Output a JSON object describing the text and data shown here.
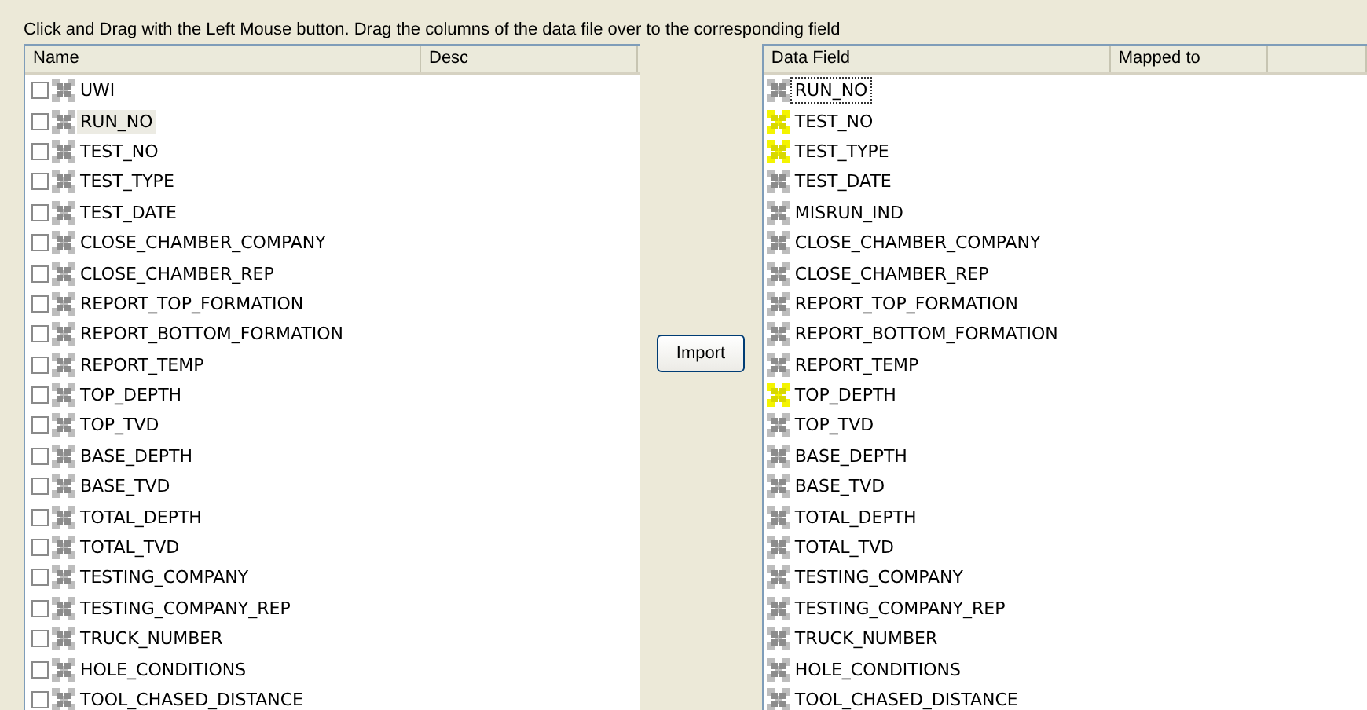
{
  "instruction": "Click and Drag with the Left Mouse button. Drag the columns of the data file over to the corresponding field",
  "source_list": {
    "columns": [
      "Name",
      "Desc"
    ],
    "rows": [
      {
        "name": "UWI",
        "checked": false,
        "selected": false
      },
      {
        "name": "RUN_NO",
        "checked": false,
        "selected": true
      },
      {
        "name": "TEST_NO",
        "checked": false,
        "selected": false
      },
      {
        "name": "TEST_TYPE",
        "checked": false,
        "selected": false
      },
      {
        "name": "TEST_DATE",
        "checked": false,
        "selected": false
      },
      {
        "name": "CLOSE_CHAMBER_COMPANY",
        "checked": false,
        "selected": false
      },
      {
        "name": "CLOSE_CHAMBER_REP",
        "checked": false,
        "selected": false
      },
      {
        "name": "REPORT_TOP_FORMATION",
        "checked": false,
        "selected": false
      },
      {
        "name": "REPORT_BOTTOM_FORMATION",
        "checked": false,
        "selected": false
      },
      {
        "name": "REPORT_TEMP",
        "checked": false,
        "selected": false
      },
      {
        "name": "TOP_DEPTH",
        "checked": false,
        "selected": false
      },
      {
        "name": "TOP_TVD",
        "checked": false,
        "selected": false
      },
      {
        "name": "BASE_DEPTH",
        "checked": false,
        "selected": false
      },
      {
        "name": "BASE_TVD",
        "checked": false,
        "selected": false
      },
      {
        "name": "TOTAL_DEPTH",
        "checked": false,
        "selected": false
      },
      {
        "name": "TOTAL_TVD",
        "checked": false,
        "selected": false
      },
      {
        "name": "TESTING_COMPANY",
        "checked": false,
        "selected": false
      },
      {
        "name": "TESTING_COMPANY_REP",
        "checked": false,
        "selected": false
      },
      {
        "name": "TRUCK_NUMBER",
        "checked": false,
        "selected": false
      },
      {
        "name": "HOLE_CONDITIONS",
        "checked": false,
        "selected": false
      },
      {
        "name": "TOOL_CHASED_DISTANCE",
        "checked": false,
        "selected": false
      }
    ]
  },
  "import_button": "Import",
  "target_list": {
    "columns": [
      "Data Field",
      "Mapped to"
    ],
    "rows": [
      {
        "name": "RUN_NO",
        "mapped": false,
        "focused": true
      },
      {
        "name": "TEST_NO",
        "mapped": true,
        "focused": false
      },
      {
        "name": "TEST_TYPE",
        "mapped": true,
        "focused": false
      },
      {
        "name": "TEST_DATE",
        "mapped": false,
        "focused": false
      },
      {
        "name": "MISRUN_IND",
        "mapped": false,
        "focused": false
      },
      {
        "name": "CLOSE_CHAMBER_COMPANY",
        "mapped": false,
        "focused": false
      },
      {
        "name": "CLOSE_CHAMBER_REP",
        "mapped": false,
        "focused": false
      },
      {
        "name": "REPORT_TOP_FORMATION",
        "mapped": false,
        "focused": false
      },
      {
        "name": "REPORT_BOTTOM_FORMATION",
        "mapped": false,
        "focused": false
      },
      {
        "name": "REPORT_TEMP",
        "mapped": false,
        "focused": false
      },
      {
        "name": "TOP_DEPTH",
        "mapped": true,
        "focused": false
      },
      {
        "name": "TOP_TVD",
        "mapped": false,
        "focused": false
      },
      {
        "name": "BASE_DEPTH",
        "mapped": false,
        "focused": false
      },
      {
        "name": "BASE_TVD",
        "mapped": false,
        "focused": false
      },
      {
        "name": "TOTAL_DEPTH",
        "mapped": false,
        "focused": false
      },
      {
        "name": "TOTAL_TVD",
        "mapped": false,
        "focused": false
      },
      {
        "name": "TESTING_COMPANY",
        "mapped": false,
        "focused": false
      },
      {
        "name": "TESTING_COMPANY_REP",
        "mapped": false,
        "focused": false
      },
      {
        "name": "TRUCK_NUMBER",
        "mapped": false,
        "focused": false
      },
      {
        "name": "HOLE_CONDITIONS",
        "mapped": false,
        "focused": false
      },
      {
        "name": "TOOL_CHASED_DISTANCE",
        "mapped": false,
        "focused": false
      }
    ]
  }
}
